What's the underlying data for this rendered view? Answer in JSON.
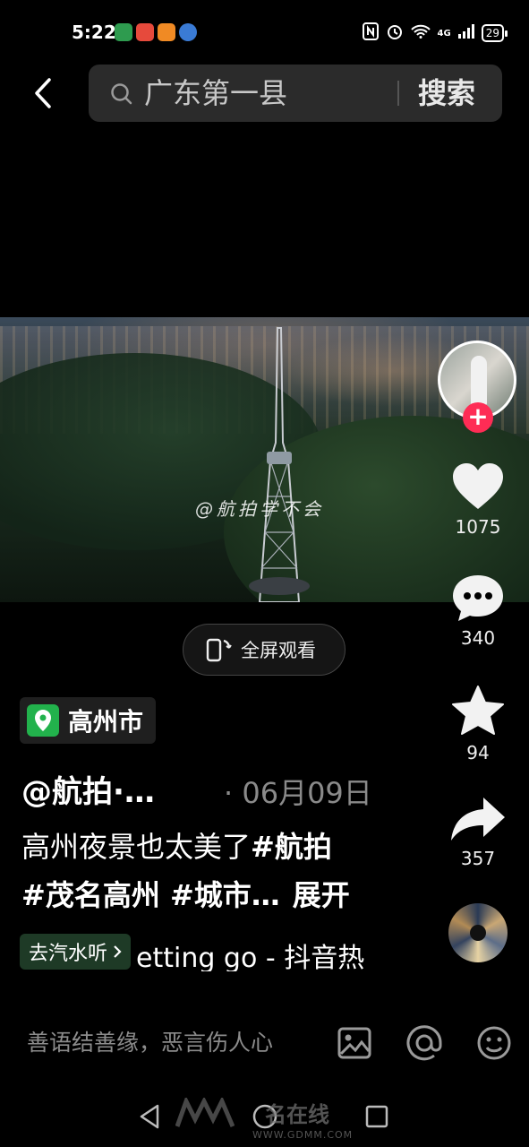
{
  "status": {
    "time": "5:22",
    "network": "4G",
    "battery": "29",
    "app_icon_colors": [
      "#2e9b4f",
      "#e64a3c",
      "#f08a24",
      "#3a7bd5"
    ]
  },
  "search": {
    "query": "广东第一县",
    "button_label": "搜索"
  },
  "video": {
    "watermark": "@航拍学不会"
  },
  "actions": {
    "likes": "1075",
    "comments": "340",
    "favorites": "94",
    "shares": "357"
  },
  "fullscreen": {
    "label": "全屏观看"
  },
  "post": {
    "location": "高州市",
    "author": "@航拍·…",
    "date": "· 06月09日",
    "caption_line1_text": "高州夜景也太美了",
    "caption_line1_tag": "#航拍",
    "caption_line2_text": "#茂名高州 #城市…",
    "expand_label": "展开",
    "listen_chip": "去汽水听",
    "music": "etting go - 抖音热"
  },
  "comment": {
    "placeholder": "善语结善缘，恶言伤人心"
  },
  "footer": {
    "site_name": "名在线",
    "site_url": "WWW.GDMM.COM"
  },
  "colors": {
    "accent_red": "#fe2c55",
    "location_green": "#22b24c"
  }
}
